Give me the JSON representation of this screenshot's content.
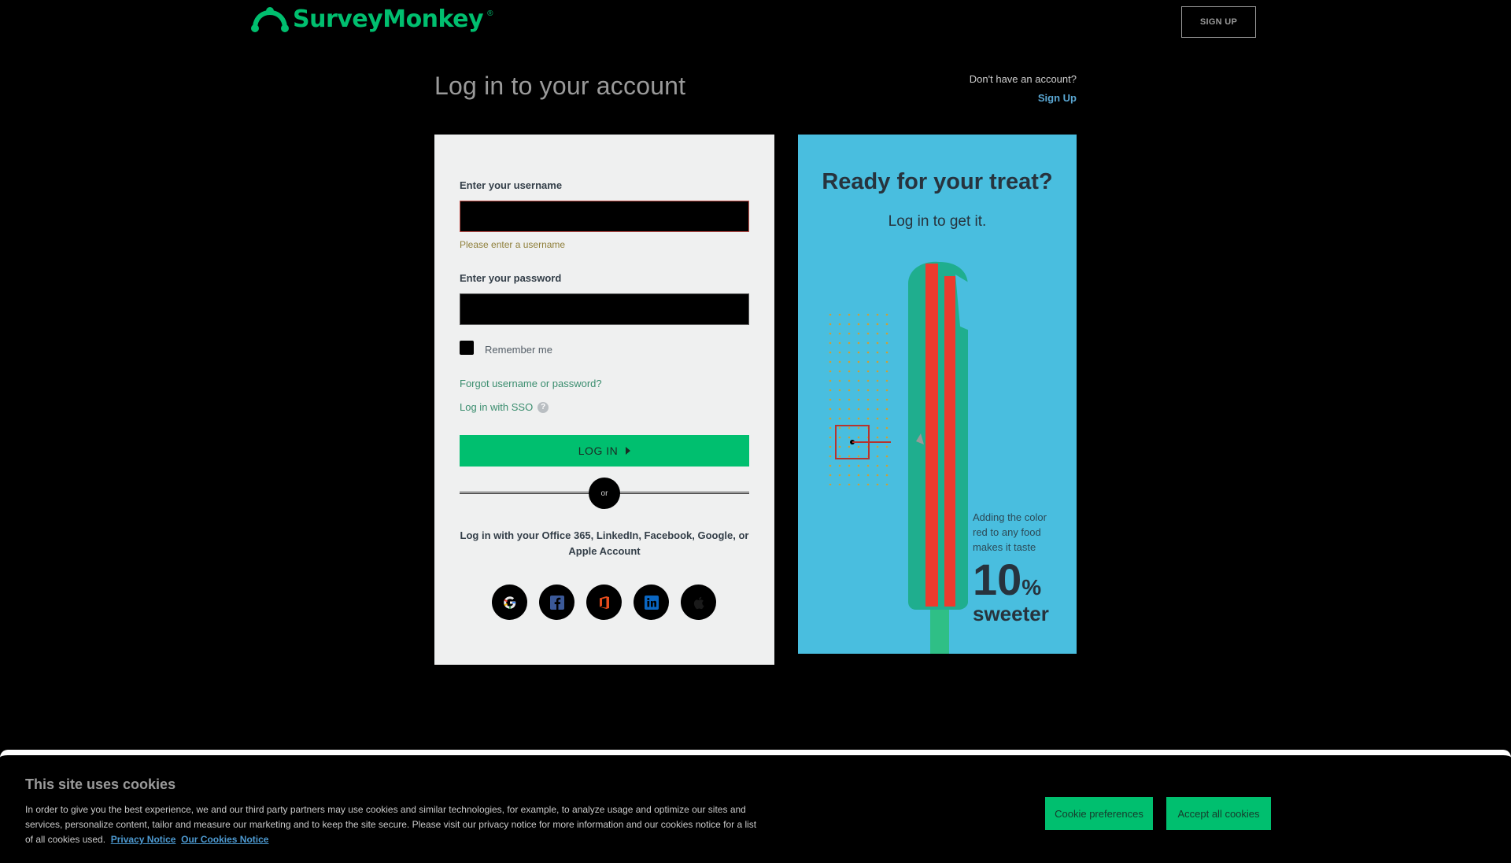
{
  "header": {
    "logo_text": "SurveyMonkey",
    "logo_reg": "®",
    "signup_button": "SIGN UP"
  },
  "title_row": {
    "title": "Log in to your account",
    "no_account": "Don't have an account?",
    "signup_link": "Sign Up"
  },
  "login": {
    "username_label": "Enter your username",
    "username_value": "",
    "username_error": "Please enter a username",
    "password_label": "Enter your password",
    "password_value": "",
    "remember_label": "Remember me",
    "forgot_link": "Forgot username or password?",
    "sso_link": "Log in with SSO",
    "help_icon": "?",
    "login_button": "LOG IN",
    "or_text": "or",
    "social_text": "Log in with your Office 365, LinkedIn, Facebook, Google, or Apple Account",
    "social_icons": [
      "google-icon",
      "facebook-icon",
      "office365-icon",
      "linkedin-icon",
      "apple-icon"
    ]
  },
  "promo": {
    "title": "Ready for your treat?",
    "subtitle": "Log in to get it.",
    "caption_line1": "Adding the color",
    "caption_line2": "red to any food",
    "caption_line3": "makes it taste",
    "number": "10",
    "percent": "%",
    "word": "sweeter"
  },
  "cookies": {
    "title": "This site uses cookies",
    "text_line1": "In order to give you the best experience, we and our third party partners may use cookies and similar technologies, for example, to analyze usage and optimize our sites and",
    "text_line2": "services, personalize content, tailor and measure our marketing and to keep the site secure. Please visit our privacy notice for more information and our cookies notice for a list",
    "text_line3": "of all cookies used.",
    "privacy_link": "Privacy Notice",
    "cookies_link": "Our Cookies Notice",
    "prefs_button": "Cookie preferences",
    "accept_button": "Accept all cookies"
  },
  "colors": {
    "brand_green": "#00bf6f",
    "promo_blue": "#49bedf",
    "panel_gray": "#eff0f0",
    "error_red": "#c24f4a"
  }
}
